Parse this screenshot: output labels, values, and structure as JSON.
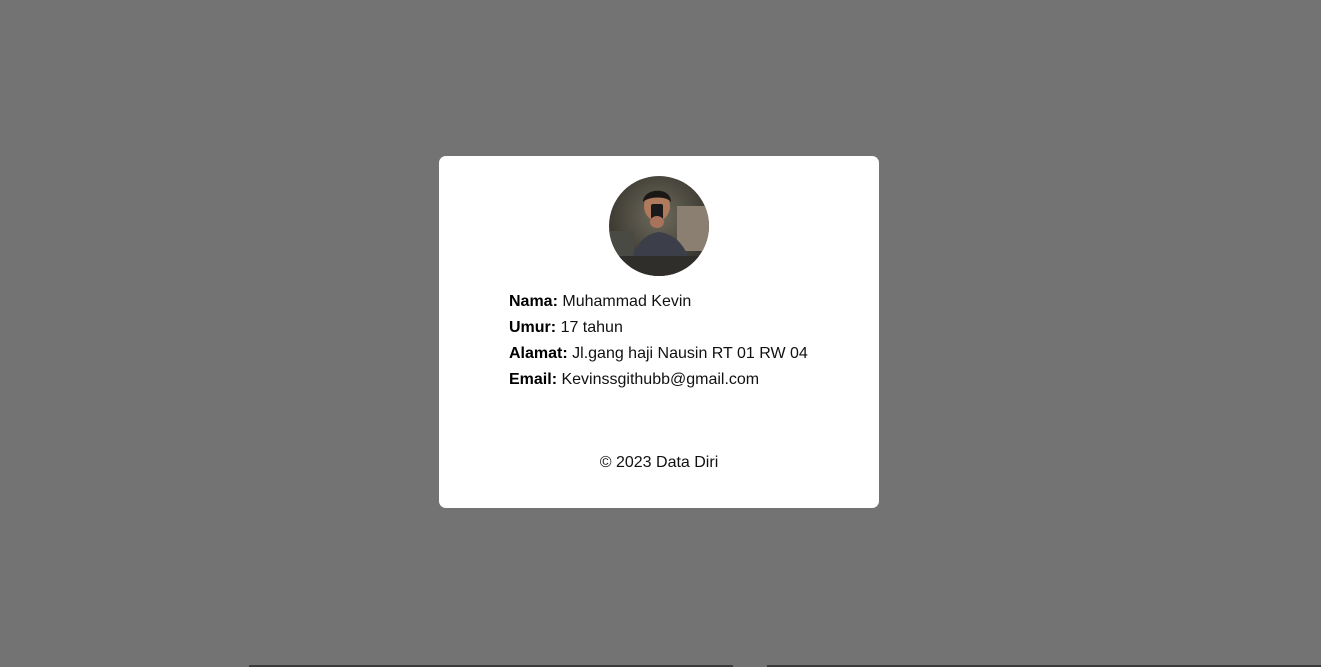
{
  "profile": {
    "photo_icon": "profile-photo",
    "fields": [
      {
        "label": "Nama:",
        "value": "Muhammad Kevin"
      },
      {
        "label": "Umur:",
        "value": "17 tahun"
      },
      {
        "label": "Alamat:",
        "value": "Jl.gang haji Nausin RT 01 RW 04"
      },
      {
        "label": "Email:",
        "value": "Kevinssgithubb@gmail.com"
      }
    ]
  },
  "footer": {
    "text": "© 2023 Data Diri"
  },
  "colors": {
    "background": "#737373",
    "card": "#ffffff",
    "text": "#111111"
  }
}
